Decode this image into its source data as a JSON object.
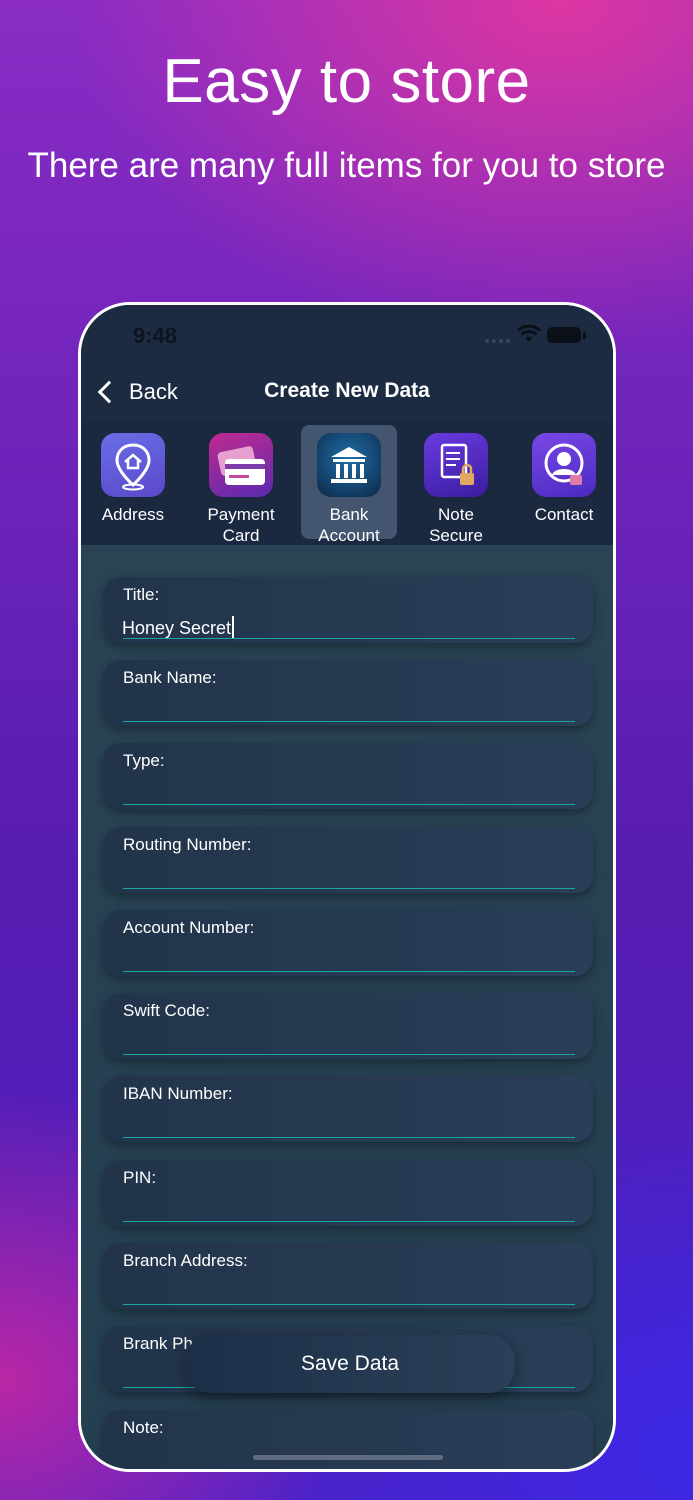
{
  "promo": {
    "headline": "Easy to store",
    "subline": "There are many full items for you to store"
  },
  "status_bar": {
    "time": "9:48"
  },
  "nav": {
    "back_label": "Back",
    "title": "Create New Data"
  },
  "categories": [
    {
      "label_line1": "Address",
      "label_line2": "",
      "icon": "home-location-icon",
      "active": false
    },
    {
      "label_line1": "Payment",
      "label_line2": "Card",
      "icon": "credit-card-icon",
      "active": false
    },
    {
      "label_line1": "Bank",
      "label_line2": "Account",
      "icon": "bank-icon",
      "active": true
    },
    {
      "label_line1": "Note",
      "label_line2": "Secure",
      "icon": "secure-note-icon",
      "active": false
    },
    {
      "label_line1": "Contact",
      "label_line2": "",
      "icon": "contact-icon",
      "active": false
    }
  ],
  "form": {
    "fields": [
      {
        "label": "Title:",
        "value": "Honey Secret"
      },
      {
        "label": "Bank Name:",
        "value": ""
      },
      {
        "label": "Type:",
        "value": ""
      },
      {
        "label": "Routing Number:",
        "value": ""
      },
      {
        "label": "Account Number:",
        "value": ""
      },
      {
        "label": "Swift Code:",
        "value": ""
      },
      {
        "label": "IBAN Number:",
        "value": ""
      },
      {
        "label": "PIN:",
        "value": ""
      },
      {
        "label": "Branch Address:",
        "value": ""
      },
      {
        "label": "Brank Ph",
        "value": ""
      },
      {
        "label": "Note:",
        "value": ""
      }
    ],
    "save_label": "Save Data"
  },
  "colors": {
    "accent_line": "#1aa7a0",
    "screen_bg": "#1f2d44"
  }
}
